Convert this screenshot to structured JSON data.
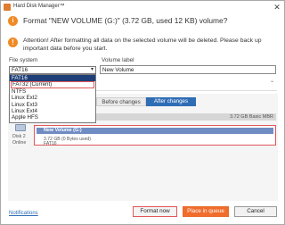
{
  "window": {
    "title": "Hard Disk Manager™",
    "close_glyph": "✕"
  },
  "dialog": {
    "heading": "Format \"NEW VOLUME (G:)\" (3.72 GB, used 12 KB) volume?",
    "warning": "Attention! After formatting all data on the selected volume will be deleted. Please back up important data before you start."
  },
  "form": {
    "file_system_label": "File system",
    "file_system_value": "FAT16",
    "volume_label_label": "Volume label",
    "volume_label_value": "New Volume",
    "file_system_options": [
      "FAT16",
      "FAT32 (Current)",
      "NTFS",
      "Linux Ext2",
      "Linux Ext3",
      "Linux Ext4",
      "Apple HFS"
    ]
  },
  "preview": {
    "tab_before": "Before changes",
    "tab_after": "After changes",
    "disk_meta": "3.72 GB Basic MBR",
    "disk_name": "Disk 2",
    "disk_status": "Online",
    "partition_label": "New Volume (G:)",
    "partition_size": "3.72 GB (0 Bytes used)",
    "partition_fs": "FAT16"
  },
  "footer": {
    "notifications": "Notifications",
    "format_now": "Format now",
    "place_in_queue": "Place in queue",
    "cancel": "Cancel"
  },
  "icons": {
    "app": "app-logo-icon",
    "heading": "info-icon",
    "warning": "exclamation-icon",
    "disk": "disk-drive-icon",
    "dropdown": "chevron-down-icon"
  },
  "colors": {
    "accent_orange": "#f06d2c",
    "selection_blue": "#1e3f78",
    "tab_active": "#2f6db5",
    "partition_bar": "#6f8cc3",
    "highlight_red": "#e0585a"
  }
}
